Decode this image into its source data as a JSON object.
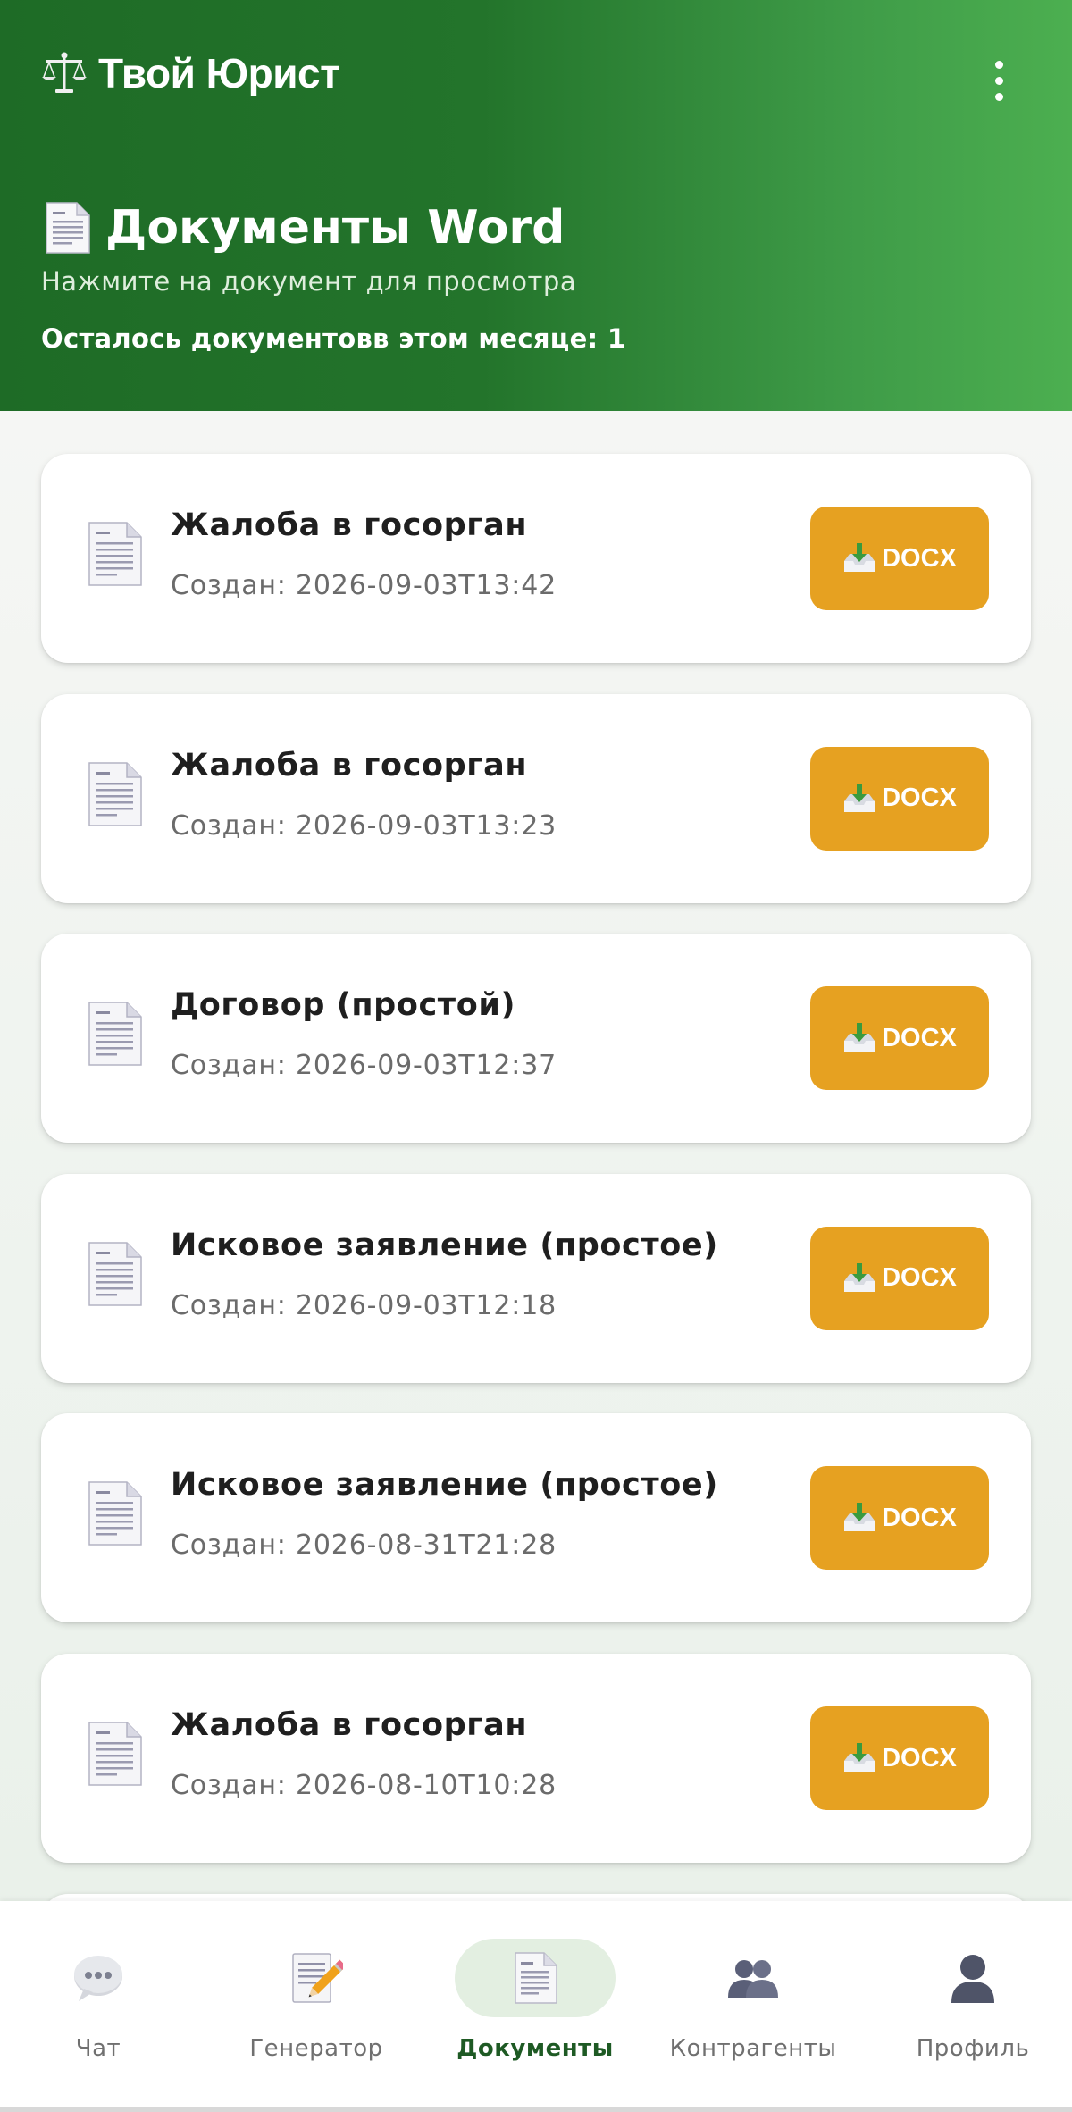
{
  "header": {
    "app_title": "Твой Юрист",
    "page_title": "Документы Word",
    "subtitle": "Нажмите на документ для просмотра",
    "quota": "Осталось документовв этом месяце: 1"
  },
  "documents": [
    {
      "title": "Жалоба в госорган",
      "date": "Создан: 2026-09-03T13:42",
      "button": "DOCX"
    },
    {
      "title": "Жалоба в госорган",
      "date": "Создан: 2026-09-03T13:23",
      "button": "DOCX"
    },
    {
      "title": "Договор (простой)",
      "date": "Создан: 2026-09-03T12:37",
      "button": "DOCX"
    },
    {
      "title": "Исковое заявление (простое)",
      "date": "Создан: 2026-09-03T12:18",
      "button": "DOCX"
    },
    {
      "title": "Исковое заявление (простое)",
      "date": "Создан: 2026-08-31T21:28",
      "button": "DOCX"
    },
    {
      "title": "Жалоба в госорган",
      "date": "Создан: 2026-08-10T10:28",
      "button": "DOCX"
    }
  ],
  "nav": {
    "items": [
      {
        "label": "Чат",
        "icon": "chat-bubble-icon"
      },
      {
        "label": "Генератор",
        "icon": "memo-icon"
      },
      {
        "label": "Документы",
        "icon": "document-icon",
        "active": true
      },
      {
        "label": "Контрагенты",
        "icon": "people-icon"
      },
      {
        "label": "Профиль",
        "icon": "person-icon"
      }
    ]
  },
  "colors": {
    "header_gradient_start": "#1e6b26",
    "header_gradient_end": "#4caf50",
    "docx_button": "#e6a121",
    "active_nav_pill": "#e3efe1",
    "active_nav_label": "#1e5a24"
  }
}
